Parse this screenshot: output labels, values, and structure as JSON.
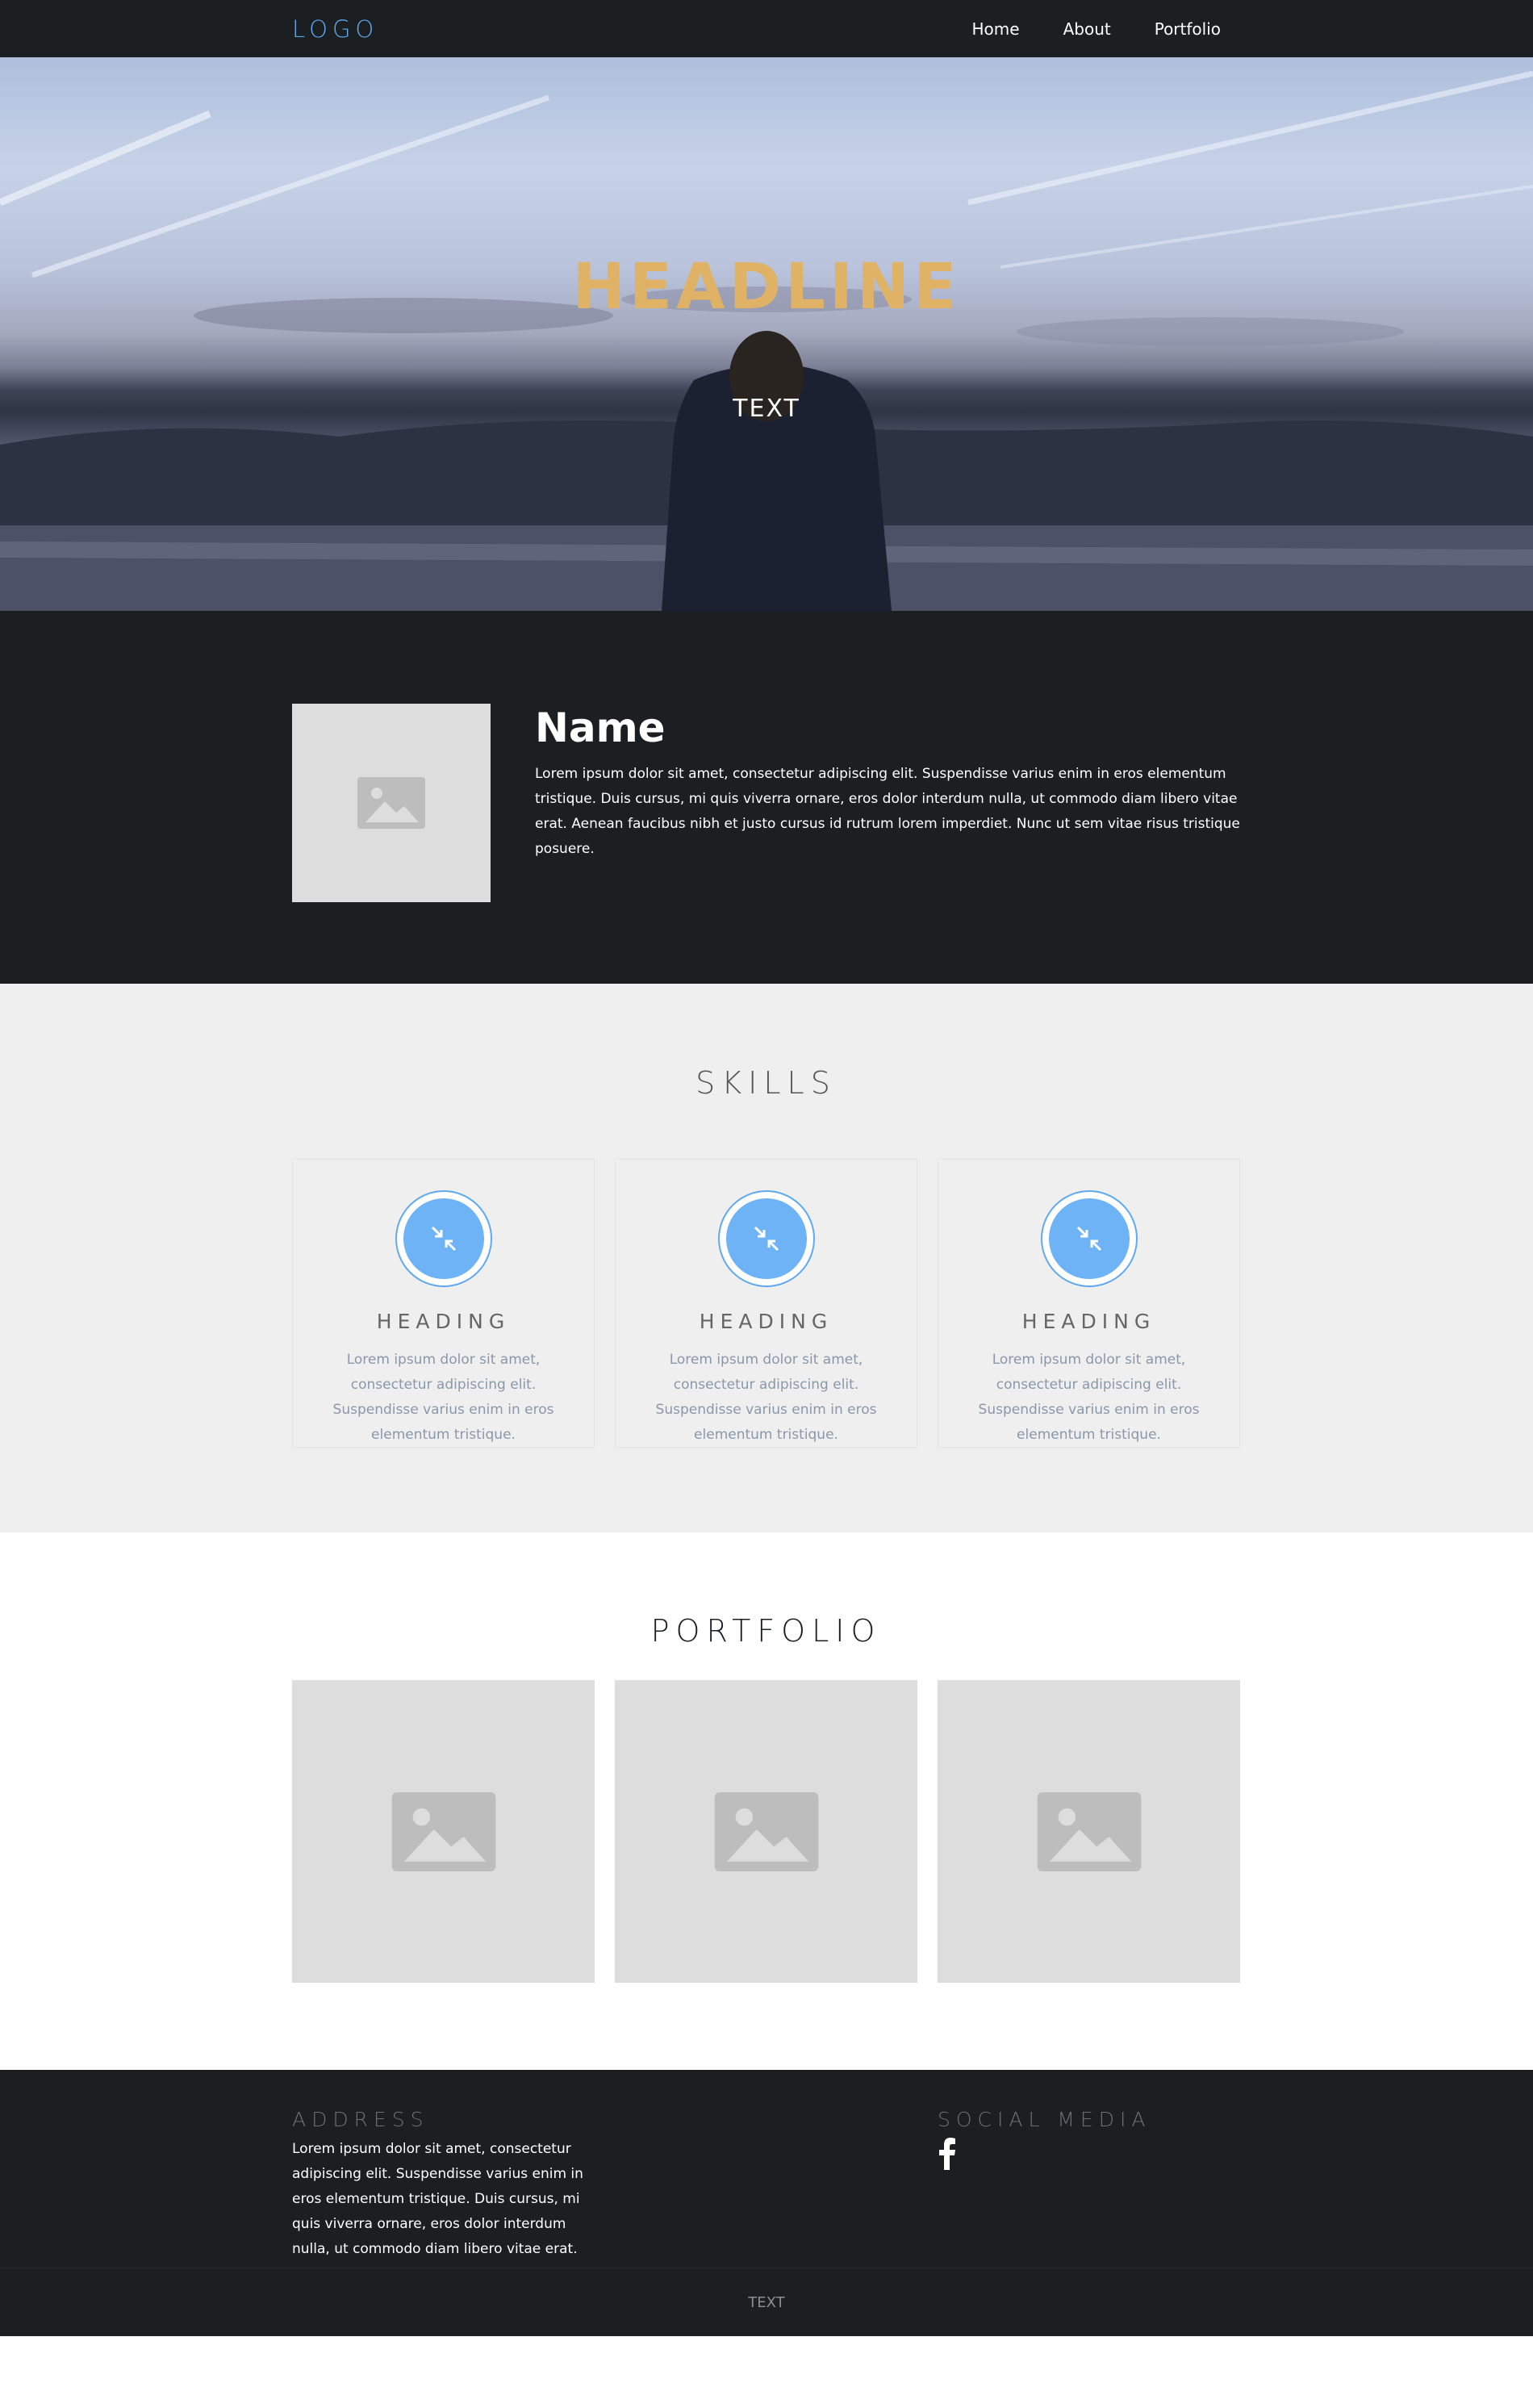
{
  "nav": {
    "logo": "LOGO",
    "items": [
      {
        "label": "Home"
      },
      {
        "label": "About"
      },
      {
        "label": "Portfolio"
      }
    ]
  },
  "hero": {
    "headline": "HEADLINE",
    "text": "TEXT"
  },
  "about": {
    "name": "Name",
    "description": "Lorem ipsum dolor sit amet, consectetur adipiscing elit. Suspendisse varius enim in eros elementum tristique. Duis cursus, mi quis viverra ornare, eros dolor interdum nulla, ut commodo diam libero vitae erat. Aenean faucibus nibh et justo cursus id rutrum lorem imperdiet. Nunc ut sem vitae risus tristique posuere."
  },
  "skills": {
    "title": "SKILLS",
    "cards": [
      {
        "heading": "HEADING",
        "text": "Lorem ipsum dolor sit amet, consectetur adipiscing elit. Suspendisse varius enim in eros elementum tristique.",
        "icon": "compress-arrows-icon"
      },
      {
        "heading": "HEADING",
        "text": "Lorem ipsum dolor sit amet, consectetur adipiscing elit. Suspendisse varius enim in eros elementum tristique.",
        "icon": "compress-arrows-icon"
      },
      {
        "heading": "HEADING",
        "text": "Lorem ipsum dolor sit amet, consectetur adipiscing elit. Suspendisse varius enim in eros elementum tristique.",
        "icon": "compress-arrows-icon"
      }
    ]
  },
  "portfolio": {
    "title": "PORTFOLIO"
  },
  "footer": {
    "address_heading": "ADDRESS",
    "address_text": "Lorem ipsum dolor sit amet, consectetur adipiscing elit. Suspendisse varius enim in eros elementum tristique. Duis cursus, mi quis viverra ornare, eros dolor interdum nulla, ut commodo diam libero vitae erat. Aenean faucibus nibh et justo cursus id rutrum lorem imperdiet. Nunc ut sem vitae risus tristique posuere.",
    "social_heading": "SOCIAL MEDIA",
    "social_icon": "facebook-icon",
    "copyright": "TEXT"
  },
  "colors": {
    "accent": "#5fa9f0",
    "headline": "#dfb265",
    "dark": "#1b1f22"
  }
}
